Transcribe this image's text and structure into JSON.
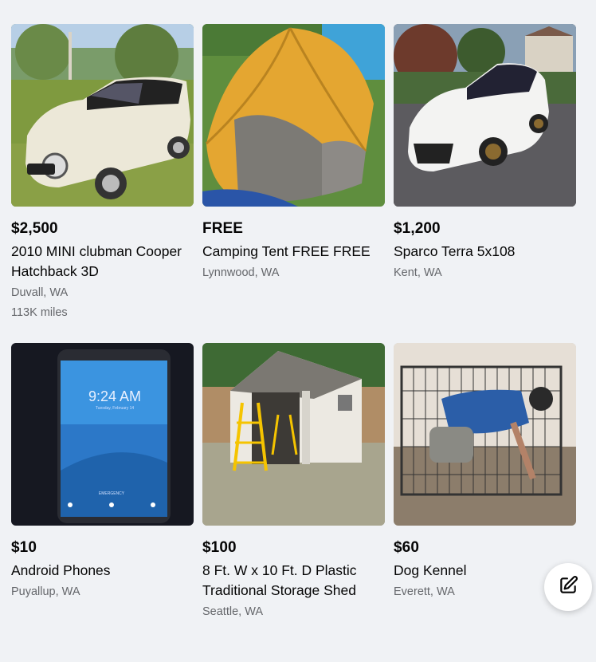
{
  "listings": [
    {
      "price": "$2,500",
      "title": "2010 MINI clubman Cooper Hatchback 3D",
      "location": "Duvall, WA",
      "extra": "113K miles",
      "image": "mini-car-photo"
    },
    {
      "price": "FREE",
      "title": "Camping Tent FREE FREE",
      "location": "Lynnwood, WA",
      "image": "tent-photo"
    },
    {
      "price": "$1,200",
      "title": "Sparco Terra 5x108",
      "location": "Kent, WA",
      "image": "white-hatchback-photo"
    },
    {
      "price": "$10",
      "title": "Android Phones",
      "location": "Puyallup, WA",
      "image": "phone-photo",
      "phone_time": "9:24 AM",
      "phone_date": "Tuesday, February 14",
      "phone_emergency": "EMERGENCY"
    },
    {
      "price": "$100",
      "title": "8 Ft. W x 10 Ft. D Plastic Traditional Storage Shed",
      "location": "Seattle, WA",
      "image": "shed-photo"
    },
    {
      "price": "$60",
      "title": "Dog Kennel",
      "location": "Everett, WA",
      "image": "kennel-photo"
    }
  ],
  "compose_icon": "compose-icon"
}
